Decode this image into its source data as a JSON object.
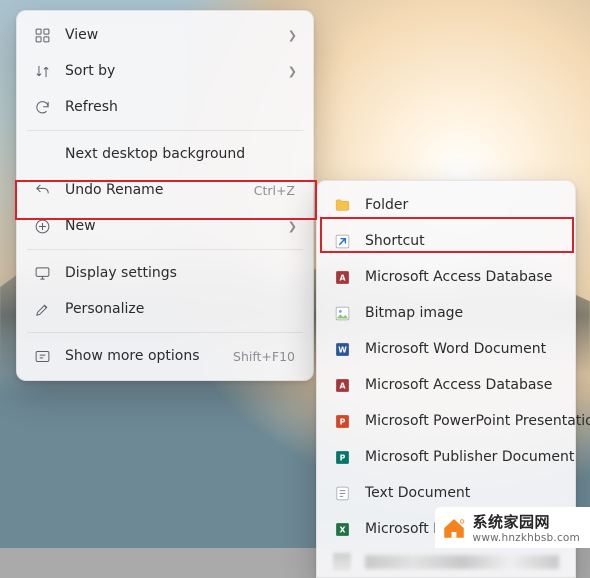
{
  "desktop_menu": {
    "items": [
      {
        "label": "View",
        "shortcut": "",
        "submenu": true
      },
      {
        "label": "Sort by",
        "shortcut": "",
        "submenu": true
      },
      {
        "label": "Refresh",
        "shortcut": "",
        "submenu": false
      },
      {
        "sep": true
      },
      {
        "label": "Next desktop background",
        "shortcut": "",
        "submenu": false
      },
      {
        "label": "Undo Rename",
        "shortcut": "Ctrl+Z",
        "submenu": false
      },
      {
        "label": "New",
        "shortcut": "",
        "submenu": true
      },
      {
        "sep": true
      },
      {
        "label": "Display settings",
        "shortcut": "",
        "submenu": false
      },
      {
        "label": "Personalize",
        "shortcut": "",
        "submenu": false
      },
      {
        "sep": true
      },
      {
        "label": "Show more options",
        "shortcut": "Shift+F10",
        "submenu": false
      }
    ]
  },
  "new_submenu": {
    "items": [
      {
        "label": "Folder"
      },
      {
        "label": "Shortcut"
      },
      {
        "label": "Microsoft Access Database"
      },
      {
        "label": "Bitmap image"
      },
      {
        "label": "Microsoft Word Document"
      },
      {
        "label": "Microsoft Access Database"
      },
      {
        "label": "Microsoft PowerPoint Presentation"
      },
      {
        "label": "Microsoft Publisher Document"
      },
      {
        "label": "Text Document"
      },
      {
        "label": "Microsoft Excel Worksheet"
      }
    ]
  },
  "watermark": {
    "title": "系统家园网",
    "url": "www.hnzkhbsb.com"
  },
  "colors": {
    "highlight_border": "#d6222a",
    "folder": "#f8c24a",
    "word": "#2b579a",
    "access": "#a4373a",
    "powerpoint": "#d24726",
    "publisher": "#077568",
    "excel": "#217346",
    "shortcut_arrow": "#1f6fd0"
  }
}
